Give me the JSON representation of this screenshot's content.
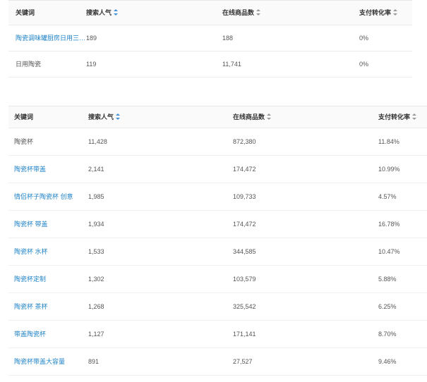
{
  "table1": {
    "headers": {
      "keyword": "关键词",
      "search_popularity": "搜索人气",
      "online_products": "在线商品数",
      "payment_conversion": "支付转化率"
    },
    "rows": [
      {
        "keyword": "陶瓷调味罐厨房日用三…",
        "search_popularity": "189",
        "online_products": "188",
        "payment_conversion": "0%",
        "is_link": true
      },
      {
        "keyword": "日用陶瓷",
        "search_popularity": "119",
        "online_products": "11,741",
        "payment_conversion": "0%",
        "is_link": false
      }
    ]
  },
  "table2": {
    "headers": {
      "keyword": "关键词",
      "search_popularity": "搜索人气",
      "online_products": "在线商品数",
      "payment_conversion": "支付转化率"
    },
    "rows": [
      {
        "keyword": "陶瓷杯",
        "search_popularity": "11,428",
        "online_products": "872,380",
        "payment_conversion": "11.84%",
        "is_link": false
      },
      {
        "keyword": "陶瓷杯带盖",
        "search_popularity": "2,141",
        "online_products": "174,472",
        "payment_conversion": "10.99%",
        "is_link": true
      },
      {
        "keyword": "情侣杯子陶瓷杯 创意",
        "search_popularity": "1,985",
        "online_products": "109,733",
        "payment_conversion": "4.57%",
        "is_link": true
      },
      {
        "keyword": "陶瓷杯 带盖",
        "search_popularity": "1,934",
        "online_products": "174,472",
        "payment_conversion": "16.78%",
        "is_link": true
      },
      {
        "keyword": "陶瓷杯 水杯",
        "search_popularity": "1,533",
        "online_products": "344,585",
        "payment_conversion": "10.47%",
        "is_link": true
      },
      {
        "keyword": "陶瓷杯定制",
        "search_popularity": "1,302",
        "online_products": "103,579",
        "payment_conversion": "5.88%",
        "is_link": true
      },
      {
        "keyword": "陶瓷杯 茶杯",
        "search_popularity": "1,268",
        "online_products": "325,542",
        "payment_conversion": "6.25%",
        "is_link": true
      },
      {
        "keyword": "带盖陶瓷杯",
        "search_popularity": "1,127",
        "online_products": "171,141",
        "payment_conversion": "8.70%",
        "is_link": true
      },
      {
        "keyword": "陶瓷杯带盖大容量",
        "search_popularity": "891",
        "online_products": "27,527",
        "payment_conversion": "9.46%",
        "is_link": true
      }
    ]
  },
  "icons": {
    "sort": "sort-arrows-icon"
  },
  "colors": {
    "link": "#1f83c7",
    "sort_active": "#3f8fd6",
    "header_bg": "#fafafa",
    "row_border": "#ececec"
  }
}
